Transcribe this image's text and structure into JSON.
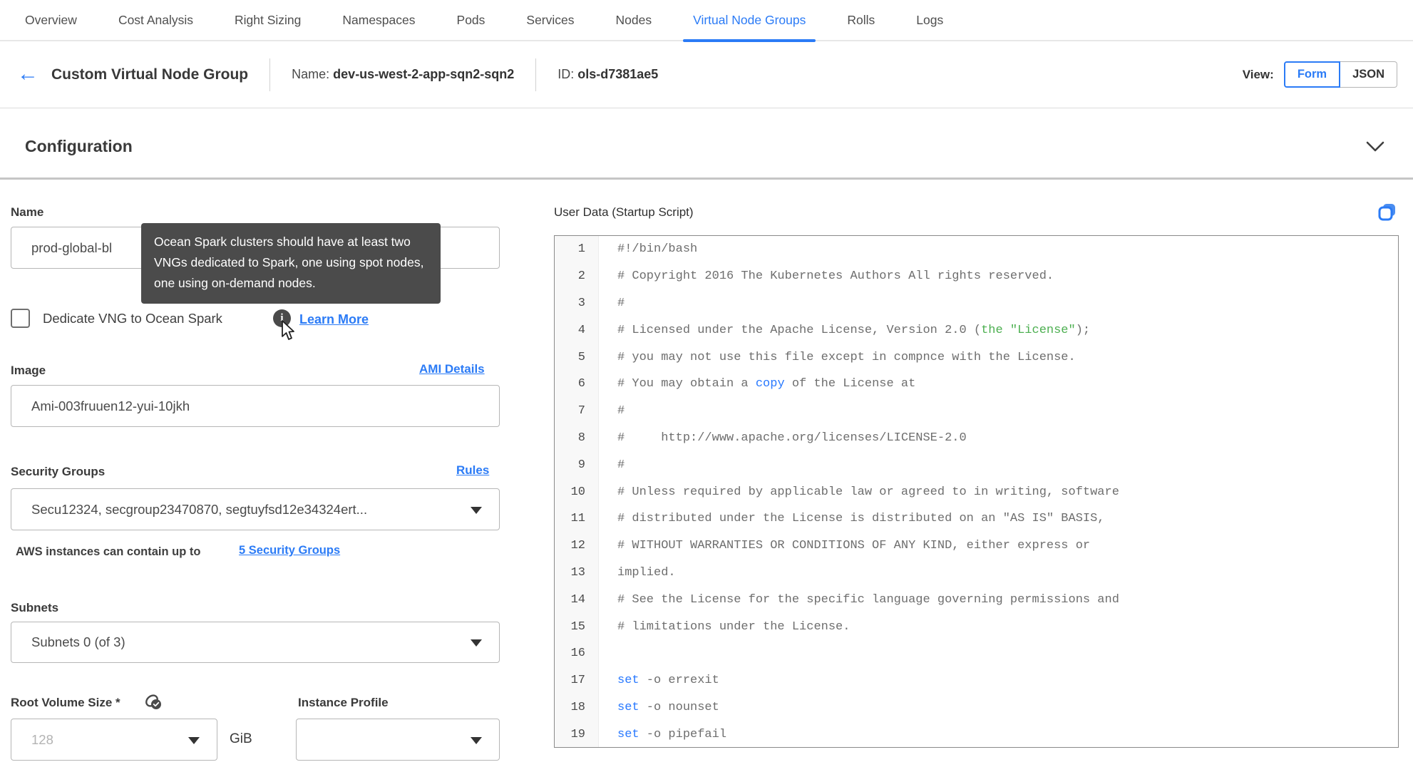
{
  "nav": {
    "tabs": [
      {
        "label": "Overview",
        "active": false
      },
      {
        "label": "Cost Analysis",
        "active": false
      },
      {
        "label": "Right Sizing",
        "active": false
      },
      {
        "label": "Namespaces",
        "active": false
      },
      {
        "label": "Pods",
        "active": false
      },
      {
        "label": "Services",
        "active": false
      },
      {
        "label": "Nodes",
        "active": false
      },
      {
        "label": "Virtual Node Groups",
        "active": true
      },
      {
        "label": "Rolls",
        "active": false
      },
      {
        "label": "Logs",
        "active": false
      }
    ]
  },
  "header": {
    "title": "Custom Virtual Node Group",
    "name_label": "Name:",
    "name_value": "dev-us-west-2-app-sqn2-sqn2",
    "id_label": "ID:",
    "id_value": "ols-d7381ae5",
    "view_label": "View:",
    "view_options": [
      "Form",
      "JSON"
    ],
    "view_selected": "Form"
  },
  "section": {
    "title": "Configuration"
  },
  "form": {
    "name": {
      "label": "Name",
      "value": "prod-global-bl"
    },
    "tooltip_text": "Ocean Spark clusters should have at least two VNGs dedicated to Spark, one using spot nodes, one using on-demand nodes.",
    "dedicate": {
      "label": "Dedicate VNG to Ocean Spark",
      "checked": false,
      "info_icon": "i",
      "learn_more": "Learn More"
    },
    "image": {
      "label": "Image",
      "value": "Ami-003fruuen12-yui-10jkh",
      "link": "AMI Details"
    },
    "security_groups": {
      "label": "Security Groups",
      "link": "Rules",
      "value": "Secu12324, secgroup23470870, segtuyfsd12e34324ert...",
      "helper_text": "AWS instances can contain up to",
      "helper_link": "5 Security Groups"
    },
    "subnets": {
      "label": "Subnets",
      "value": "Subnets 0 (of 3)"
    },
    "root_volume": {
      "label": "Root Volume Size *",
      "placeholder": "128",
      "unit": "GiB"
    },
    "instance_profile": {
      "label": "Instance Profile",
      "value": ""
    }
  },
  "user_data": {
    "label": "User Data (Startup Script)",
    "lines": [
      {
        "n": "1",
        "segs": [
          [
            "#!/bin/bash",
            "d"
          ]
        ]
      },
      {
        "n": "2",
        "segs": [
          [
            "# Copyright 2016 The Kubernetes Authors All rights reserved.",
            "d"
          ]
        ]
      },
      {
        "n": "3",
        "segs": [
          [
            "#",
            "d"
          ]
        ]
      },
      {
        "n": "4",
        "segs": [
          [
            "# Licensed under the Apache License, Version 2.0 (",
            "d"
          ],
          [
            "the \"License\"",
            "g"
          ],
          [
            ");",
            "d"
          ]
        ]
      },
      {
        "n": "5",
        "segs": [
          [
            "# you may not use this file except in compnce with the License.",
            "d"
          ]
        ]
      },
      {
        "n": "6",
        "segs": [
          [
            "# You may obtain a ",
            "d"
          ],
          [
            "copy",
            "b"
          ],
          [
            " of the License at",
            "d"
          ]
        ]
      },
      {
        "n": "7",
        "segs": [
          [
            "#",
            "d"
          ]
        ]
      },
      {
        "n": "8",
        "segs": [
          [
            "#     http://www.apache.org/licenses/LICENSE-2.0",
            "d"
          ]
        ]
      },
      {
        "n": "9",
        "segs": [
          [
            "#",
            "d"
          ]
        ]
      },
      {
        "n": "10",
        "segs": [
          [
            "# Unless required by applicable law or agreed to in writing, software",
            "d"
          ]
        ]
      },
      {
        "n": "11",
        "segs": [
          [
            "# distributed under the License is distributed on an \"AS IS\" BASIS,",
            "d"
          ]
        ]
      },
      {
        "n": "12",
        "segs": [
          [
            "# WITHOUT WARRANTIES OR CONDITIONS OF ANY KIND, either express or",
            "d"
          ]
        ]
      },
      {
        "n": "13",
        "segs": [
          [
            "implied.",
            "d"
          ]
        ]
      },
      {
        "n": "14",
        "segs": [
          [
            "# See the License for the specific language governing permissions and",
            "d"
          ]
        ]
      },
      {
        "n": "15",
        "segs": [
          [
            "# limitations under the License.",
            "d"
          ]
        ]
      },
      {
        "n": "16",
        "segs": []
      },
      {
        "n": "17",
        "segs": [
          [
            "set",
            "b"
          ],
          [
            " -o errexit",
            "d"
          ]
        ]
      },
      {
        "n": "18",
        "segs": [
          [
            "set",
            "b"
          ],
          [
            " -o nounset",
            "d"
          ]
        ]
      },
      {
        "n": "19",
        "segs": [
          [
            "set",
            "b"
          ],
          [
            " -o pipefail",
            "d"
          ]
        ]
      }
    ]
  },
  "colors": {
    "accent_blue": "#2b7bf6",
    "code_default": "#6e6e6e",
    "code_green": "#4caf50",
    "code_blue": "#2979ff",
    "tooltip_bg": "#4b4b4b"
  }
}
